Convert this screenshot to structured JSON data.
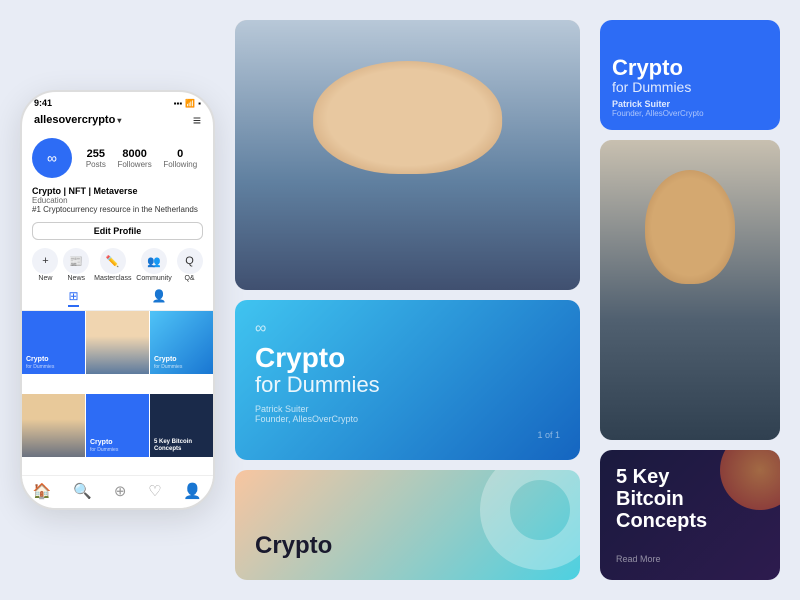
{
  "phone": {
    "time": "9:41",
    "username": "allesovercrypto",
    "stats": [
      {
        "value": "255",
        "label": "Posts"
      },
      {
        "value": "8000",
        "label": "Followers"
      },
      {
        "value": "0",
        "label": "Following"
      }
    ],
    "bio": {
      "name": "Crypto | NFT | Metaverse",
      "category": "Education",
      "description": "#1 Cryptocurrency resource in the Netherlands"
    },
    "edit_button": "Edit Profile",
    "actions": [
      {
        "label": "New",
        "icon": "+"
      },
      {
        "label": "News",
        "icon": "📰"
      },
      {
        "label": "Masterclass",
        "icon": "✏️"
      },
      {
        "label": "Community",
        "icon": "👥"
      },
      {
        "label": "Q&",
        "icon": "Q"
      }
    ],
    "grid": [
      {
        "type": "blue",
        "title": "Crypto",
        "subtitle": "for Dummies"
      },
      {
        "type": "photo_bearded"
      },
      {
        "type": "gradient",
        "title": "Crypto",
        "subtitle": "for Dummies"
      },
      {
        "type": "photo_asian"
      },
      {
        "type": "blue_overlay",
        "title": "Crypto",
        "subtitle": "for Dummies"
      },
      {
        "type": "dark",
        "title": "5 Key Bitcoin Concepts"
      }
    ]
  },
  "middle": {
    "card1_type": "photo_bearded",
    "card2": {
      "logo": "∞",
      "title": "Crypto",
      "subtitle": "for Dummies",
      "author_name": "Patrick Suiter",
      "author_role": "Founder, AllesOverCrypto",
      "page": "1 of 1"
    },
    "card3": {
      "title": "Crypto"
    }
  },
  "right": {
    "card1": {
      "title": "Crypto",
      "subtitle": "for Dummies",
      "author_name": "Patrick Suiter",
      "author_role": "Founder, AllesOverCrypto"
    },
    "card2_type": "photo_asian",
    "card3": {
      "title": "5 Key\nBitcoin\nConcepts",
      "read_more": "Read More"
    }
  }
}
